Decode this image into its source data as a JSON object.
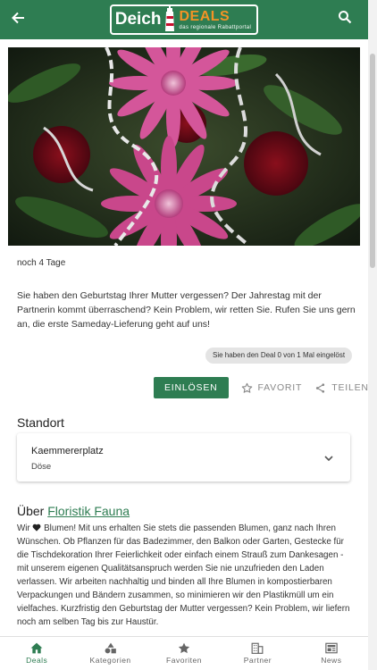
{
  "appbar": {
    "logo_left": "Deich",
    "logo_right": "DEALS",
    "logo_tagline": "das regionale Rabattportal"
  },
  "deal": {
    "remaining": "noch 4 Tage",
    "description": "Sie haben den Geburtstag Ihrer Mutter vergessen? Der Jahrestag mit der Partnerin kommt überraschend? Kein Problem, wir retten Sie. Rufen Sie uns gern an, die erste Sameday-Lieferung geht auf uns!",
    "redeem_status": "Sie haben den Deal 0 von 1 Mal eingelöst",
    "redeem_label": "EINLÖSEN",
    "favorite_label": "FAVORIT",
    "share_label": "TEILEN"
  },
  "location": {
    "heading": "Standort",
    "name": "Kaemmererplatz",
    "city": "Döse"
  },
  "about": {
    "prefix": "Über ",
    "partner_name": "Floristik Fauna",
    "text_part1": "Wir ",
    "text_part2": " Blumen! Mit uns erhalten Sie stets die passenden Blumen, ganz nach Ihren Wünschen. Ob Pflanzen für das Badezimmer, den Balkon oder Garten, Gestecke für die Tischdekoration Ihrer Feierlichkeit oder einfach einem Strauß zum Dankesagen - mit unserem eigenen Qualitätsanspruch werden Sie nie unzufrieden den Laden verlassen. Wir arbeiten nachhaltig und binden all Ihre Blumen in kompostierbaren Verpackungen und Bändern zusammen, so minimieren wir den Plastikmüll um ein vielfaches. Kurzfristig den Geburtstag der Mutter vergessen? Kein Problem, wir liefern noch am selben Tag bis zur Haustür."
  },
  "nav": {
    "items": [
      {
        "label": "Deals",
        "icon": "home-icon",
        "active": true
      },
      {
        "label": "Kategorien",
        "icon": "shapes-icon",
        "active": false
      },
      {
        "label": "Favoriten",
        "icon": "star-icon",
        "active": false
      },
      {
        "label": "Partner",
        "icon": "building-icon",
        "active": false
      },
      {
        "label": "News",
        "icon": "newspaper-icon",
        "active": false
      }
    ]
  },
  "colors": {
    "primary": "#2e7d52",
    "accent": "#f39325"
  }
}
